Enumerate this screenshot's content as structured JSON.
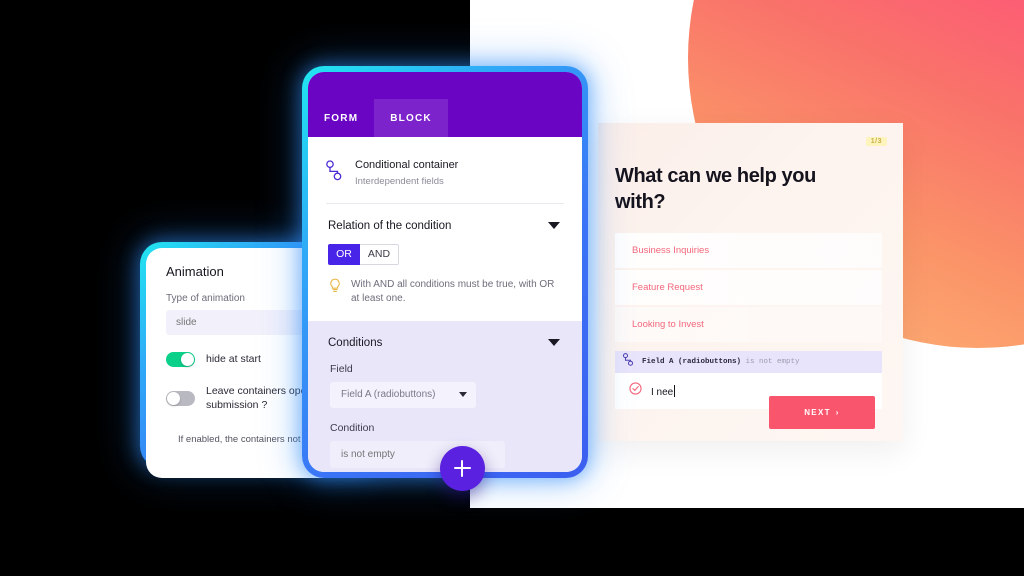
{
  "canvas": {
    "accent_purple": "#6a05c4",
    "accent_blue": "#4824e8",
    "accent_pink": "#f9556d",
    "glow_cyan": "#21e6f0"
  },
  "preview": {
    "badge": "1/3",
    "title": "What can we help you with?",
    "choices": [
      "Business Inquiries",
      "Feature Request",
      "Looking to Invest"
    ],
    "condition_strip": {
      "field": "Field A (radiobuttons)",
      "operator": "is not empty",
      "icon": "branch-icon"
    },
    "answer": {
      "icon": "check-circle-icon",
      "value": "I nee"
    },
    "next_label": "NEXT",
    "next_chevron": "›"
  },
  "animation_panel": {
    "title": "Animation",
    "type_label": "Type of animation",
    "type_value": "slide",
    "type_placeholder": "slide",
    "toggles": [
      {
        "label": "hide at start",
        "state": "on"
      },
      {
        "label": "Leave containers open after submission ?",
        "state": "off"
      }
    ],
    "footnote": "If enabled, the containers not rese"
  },
  "condition_panel": {
    "tabs": [
      {
        "label": "FORM",
        "active": false
      },
      {
        "label": "BLOCK",
        "active": true
      }
    ],
    "block": {
      "icon": "branch-icon",
      "title": "Conditional container",
      "subtitle": "Interdependent fields"
    },
    "relation": {
      "heading": "Relation of the condition",
      "options": [
        {
          "label": "OR",
          "selected": true
        },
        {
          "label": "AND",
          "selected": false
        }
      ],
      "hint_icon": "lightbulb-icon",
      "hint": "With AND all conditions must be true, with OR at least one."
    },
    "conditions": {
      "heading": "Conditions",
      "field_label": "Field",
      "field_value": "Field A (radiobuttons)",
      "condition_label": "Condition",
      "condition_value": "is not empty",
      "condition_placeholder": "is not empty"
    },
    "add_button_icon": "plus-icon"
  }
}
